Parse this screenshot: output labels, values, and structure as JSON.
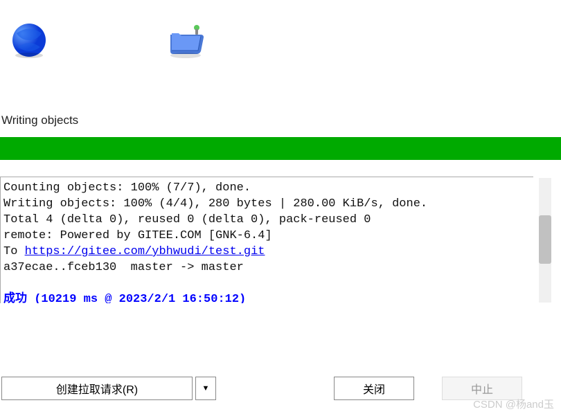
{
  "status_label": "Writing objects",
  "progress": {
    "color": "#00aa00",
    "percent": 100
  },
  "output": {
    "line1": "Counting objects: 100% (7/7), done.",
    "line2": "Writing objects: 100% (4/4), 280 bytes | 280.00 KiB/s, done.",
    "line3": "Total 4 (delta 0), reused 0 (delta 0), pack-reused 0",
    "line4": "remote: Powered by GITEE.COM [GNK-6.4]",
    "line5_prefix": "To ",
    "line5_url": "https://gitee.com/ybhwudi/test.git",
    "line6": "a37ecae..fceb130  master -> master",
    "line7_blank": "",
    "line8_success": "成功 (10219 ms @ 2023/2/1 16:50:12)"
  },
  "buttons": {
    "create_pr": "创建拉取请求(R)",
    "close": "关闭",
    "abort": "中止"
  },
  "watermark": "CSDN @杨and玉",
  "icons": {
    "globe": "globe-icon",
    "folder": "folder-icon",
    "dropdown": "▼"
  }
}
